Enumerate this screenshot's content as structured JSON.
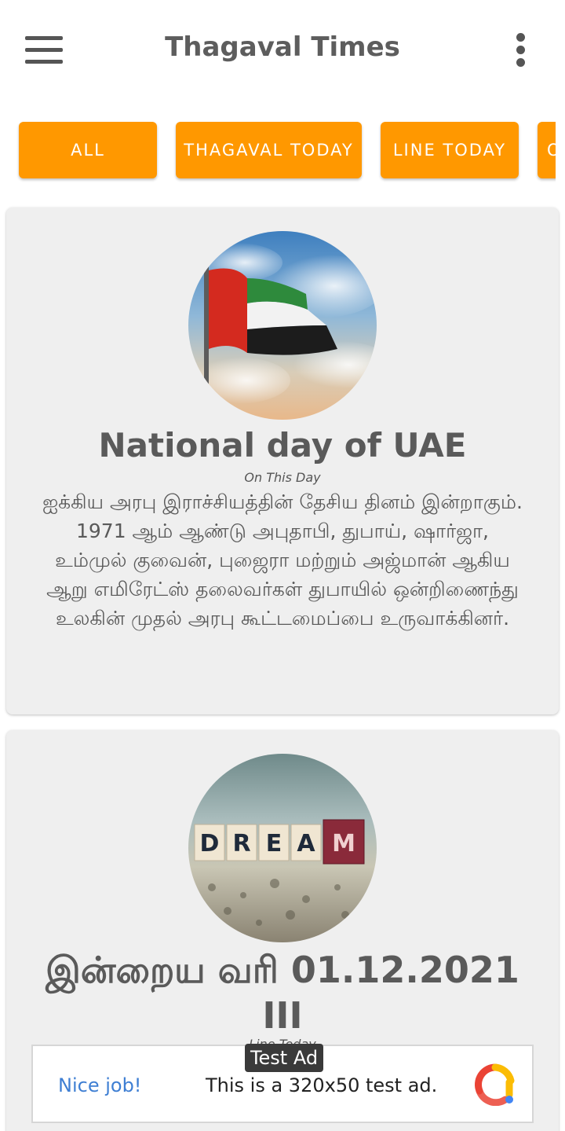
{
  "app_bar": {
    "title": "Thagaval Times",
    "menu_icon": "hamburger-menu-icon",
    "overflow_icon": "more-vert-icon"
  },
  "tabs": [
    {
      "label": "ALL"
    },
    {
      "label": "THAGAVAL TODAY"
    },
    {
      "label": "LINE TODAY"
    },
    {
      "label": "O"
    }
  ],
  "colors": {
    "accent": "#ff9800",
    "card_bg": "#efefef",
    "title_text": "#5a5a5a",
    "ad_link": "#3f7fd3"
  },
  "cards": [
    {
      "image": "uae-flag-image",
      "title": "National day of UAE",
      "category": "On This Day",
      "body": "ஐக்கிய அரபு இராச்சியத்தின் தேசிய தினம் இன்றாகும். 1971 ஆம் ஆண்டு அபுதாபி, துபாய், ஷார்ஜா, உம்முல் குவைன், புஜைரா மற்றும் அஜ்மான் ஆகிய ஆறு எமிரேட்ஸ் தலைவர்கள் துபாயில் ஒன்றிணைந்து உலகின் முதல் அரபு கூட்டமைப்பை உருவாக்கினர்."
    },
    {
      "image": "dream-blocks-image",
      "title": "இன்றைய வரி 01.12.2021 III",
      "category": "Line Today"
    }
  ],
  "ad": {
    "badge": "Test Ad",
    "link_text": "Nice job!",
    "text": "This is a 320x50 test ad.",
    "logo_icon": "admob-logo-icon"
  }
}
